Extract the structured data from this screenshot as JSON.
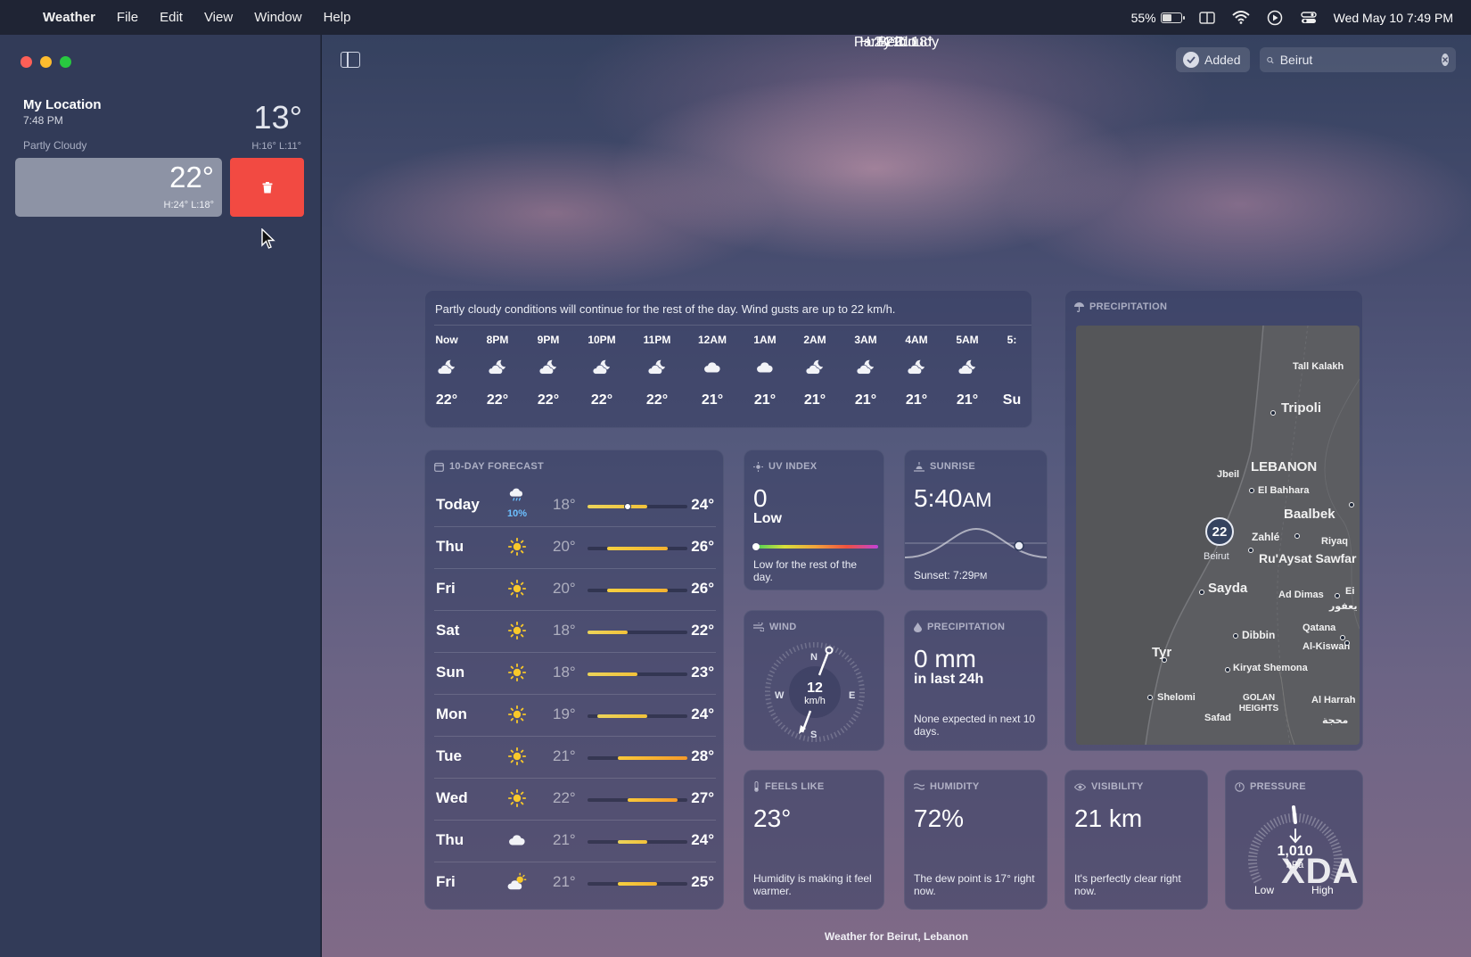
{
  "menubar": {
    "app": "Weather",
    "items": [
      "File",
      "Edit",
      "View",
      "Window",
      "Help"
    ],
    "battery": "55%",
    "datetime": "Wed May 10  7:49 PM",
    "battery_level": 0.55
  },
  "sidebar": {
    "my_location": {
      "name": "My Location",
      "time": "7:48 PM",
      "condition": "Partly Cloudy",
      "temp": "13°",
      "hl": "H:16°  L:11°"
    },
    "selected": {
      "temp": "22°",
      "hl": "H:24°  L:18°"
    }
  },
  "toolbar": {
    "added_label": "Added",
    "search_value": "Beirut"
  },
  "hero": {
    "city": "Beirut",
    "temp": "22°",
    "condition": "Partly Cloudy",
    "hl": "H:24°  L:18°"
  },
  "hourly": {
    "summary": "Partly cloudy conditions will continue for the rest of the day. Wind gusts are up to 22 km/h.",
    "hours": [
      {
        "label": "Now",
        "icon": "moon-cloud-icon",
        "temp": "22°"
      },
      {
        "label": "8PM",
        "icon": "moon-cloud-icon",
        "temp": "22°"
      },
      {
        "label": "9PM",
        "icon": "moon-cloud-icon",
        "temp": "22°"
      },
      {
        "label": "10PM",
        "icon": "moon-cloud-icon",
        "temp": "22°"
      },
      {
        "label": "11PM",
        "icon": "moon-cloud-icon",
        "temp": "22°"
      },
      {
        "label": "12AM",
        "icon": "cloud-icon",
        "temp": "21°"
      },
      {
        "label": "1AM",
        "icon": "cloud-icon",
        "temp": "21°"
      },
      {
        "label": "2AM",
        "icon": "moon-cloud-icon",
        "temp": "21°"
      },
      {
        "label": "3AM",
        "icon": "moon-cloud-icon",
        "temp": "21°"
      },
      {
        "label": "4AM",
        "icon": "moon-cloud-icon",
        "temp": "21°"
      },
      {
        "label": "5AM",
        "icon": "moon-cloud-icon",
        "temp": "21°"
      },
      {
        "label": "5:",
        "icon": "",
        "temp": "Su"
      }
    ]
  },
  "tenday": {
    "title": "10-DAY FORECAST",
    "range": [
      18,
      28
    ],
    "days": [
      {
        "name": "Today",
        "icon": "rain-cloud-icon",
        "pop": "10%",
        "low": "18°",
        "high": "24°",
        "low_v": 18,
        "high_v": 24,
        "now_v": 22
      },
      {
        "name": "Thu",
        "icon": "sun-icon",
        "pop": "",
        "low": "20°",
        "high": "26°",
        "low_v": 20,
        "high_v": 26
      },
      {
        "name": "Fri",
        "icon": "sun-icon",
        "pop": "",
        "low": "20°",
        "high": "26°",
        "low_v": 20,
        "high_v": 26
      },
      {
        "name": "Sat",
        "icon": "sun-icon",
        "pop": "",
        "low": "18°",
        "high": "22°",
        "low_v": 18,
        "high_v": 22
      },
      {
        "name": "Sun",
        "icon": "sun-icon",
        "pop": "",
        "low": "18°",
        "high": "23°",
        "low_v": 18,
        "high_v": 23
      },
      {
        "name": "Mon",
        "icon": "sun-icon",
        "pop": "",
        "low": "19°",
        "high": "24°",
        "low_v": 19,
        "high_v": 24
      },
      {
        "name": "Tue",
        "icon": "sun-icon",
        "pop": "",
        "low": "21°",
        "high": "28°",
        "low_v": 21,
        "high_v": 28
      },
      {
        "name": "Wed",
        "icon": "sun-icon",
        "pop": "",
        "low": "22°",
        "high": "27°",
        "low_v": 22,
        "high_v": 27
      },
      {
        "name": "Thu",
        "icon": "cloud-icon",
        "pop": "",
        "low": "21°",
        "high": "24°",
        "low_v": 21,
        "high_v": 24
      },
      {
        "name": "Fri",
        "icon": "sun-cloud-icon",
        "pop": "",
        "low": "21°",
        "high": "25°",
        "low_v": 21,
        "high_v": 25
      }
    ]
  },
  "uv": {
    "title": "UV INDEX",
    "value": "0",
    "level": "Low",
    "note": "Low for the rest of the day."
  },
  "sunrise": {
    "title": "SUNRISE",
    "time": "5:40",
    "ampm": "AM",
    "sunset": "Sunset: 7:29",
    "sunset_ampm": "PM"
  },
  "wind": {
    "title": "WIND",
    "speed": "12",
    "unit": "km/h",
    "n": "N",
    "e": "E",
    "s": "S",
    "w": "W"
  },
  "precip": {
    "title": "PRECIPITATION",
    "value": "0 mm",
    "period": "in last 24h",
    "note": "None expected in next 10 days."
  },
  "precip_map": {
    "title": "PRECIPITATION",
    "pin_temp": "22",
    "pin_label": "Beirut",
    "places": [
      "Tall Kalakh",
      "Tripoli",
      "LEBANON",
      "Jbeil",
      "El Bahhara",
      "Baalbek",
      "Zahlé",
      "Riyaq",
      "Ru'Aysat Sawfar",
      "Sayda",
      "Ad Dimas",
      "Ei",
      "يعفور",
      "Qatana",
      "Dibbin",
      "Al-Kiswah",
      "Tyr",
      "Kiryat Shemona",
      "Shelomi",
      "GOLAN HEIGHTS",
      "Al Harrah",
      "Safad",
      "محجة"
    ]
  },
  "feels": {
    "title": "FEELS LIKE",
    "value": "23°",
    "note": "Humidity is making it feel warmer."
  },
  "humidity": {
    "title": "HUMIDITY",
    "value": "72%",
    "note": "The dew point is 17° right now."
  },
  "visibility": {
    "title": "VISIBILITY",
    "value": "21 km",
    "note": "It's perfectly clear right now."
  },
  "pressure": {
    "title": "PRESSURE",
    "value": "1,010",
    "unit": "hPa",
    "low": "Low",
    "high": "High"
  },
  "watermark": "XDA",
  "footer": "Weather for Beirut, Lebanon",
  "colors": {
    "delete": "#f24a42",
    "sidebar": "#323b58",
    "selected_row": "#8d93a5",
    "pop": "#6cc0ff"
  }
}
